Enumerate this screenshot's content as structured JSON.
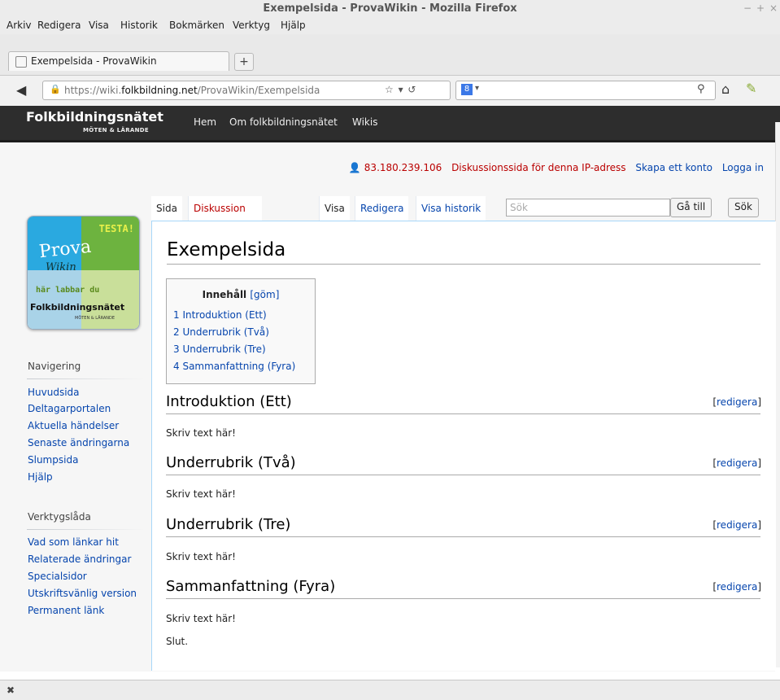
{
  "window": {
    "title": "Exempelsida - ProvaWikin - Mozilla Firefox"
  },
  "menu": [
    "Arkiv",
    "Redigera",
    "Visa",
    "Historik",
    "Bokmärken",
    "Verktyg",
    "Hjälp"
  ],
  "browser_tab": {
    "title": "Exempelsida - ProvaWikin",
    "new_tab": "+"
  },
  "urlbar": {
    "prefix": "https://wiki.",
    "domain": "folkbildning.net",
    "path": "/ProvaWikin/Exempelsida",
    "icons": "☆ ▾ ↺"
  },
  "search_engine": {
    "letter": "8",
    "dropdown": "▾"
  },
  "site": {
    "logo": "Folkbildningsnätet",
    "logo_sub": "MÖTEN & LÄRANDE",
    "nav": [
      "Hem",
      "Om folkbildningsnätet",
      "Wikis"
    ]
  },
  "personal": {
    "ip": "83.180.239.106",
    "talk": "Diskussionssida för denna IP-adress",
    "create": "Skapa ett konto",
    "login": "Logga in"
  },
  "tabs": {
    "page": "Sida",
    "talk": "Diskussion",
    "view": "Visa",
    "edit": "Redigera",
    "history": "Visa historik"
  },
  "search": {
    "placeholder": "Sök",
    "go": "Gå till",
    "search": "Sök"
  },
  "page": {
    "title": "Exempelsida",
    "toc": {
      "title": "Innehåll",
      "toggle": "[göm]",
      "items": [
        "1 Introduktion (Ett)",
        "2 Underrubrik (Två)",
        "3 Underrubrik (Tre)",
        "4 Sammanfattning (Fyra)"
      ]
    },
    "sections": [
      {
        "heading": "Introduktion (Ett)",
        "text": "Skriv text här!"
      },
      {
        "heading": "Underrubrik (Två)",
        "text": "Skriv text här!"
      },
      {
        "heading": "Underrubrik (Tre)",
        "text": "Skriv text här!"
      },
      {
        "heading": "Sammanfattning (Fyra)",
        "text": "Skriv text här!"
      }
    ],
    "edit_label": "redigera",
    "end_text": "Slut."
  },
  "sidebar": {
    "logo": {
      "testa": "TESTA!",
      "prova": "Prova",
      "wikin": "Wikin",
      "har": "här labbar du",
      "folk": "Folkbildningsnätet",
      "sub": "MÖTEN & LÄRANDE"
    },
    "navigation_heading": "Navigering",
    "navigation": [
      "Huvudsida",
      "Deltagarportalen",
      "Aktuella händelser",
      "Senaste ändringarna",
      "Slumpsida",
      "Hjälp"
    ],
    "toolbox_heading": "Verktygslåda",
    "toolbox": [
      "Vad som länkar hit",
      "Relaterade ändringar",
      "Specialsidor",
      "Utskriftsvänlig version",
      "Permanent länk"
    ]
  },
  "status": {
    "close": "✖"
  }
}
